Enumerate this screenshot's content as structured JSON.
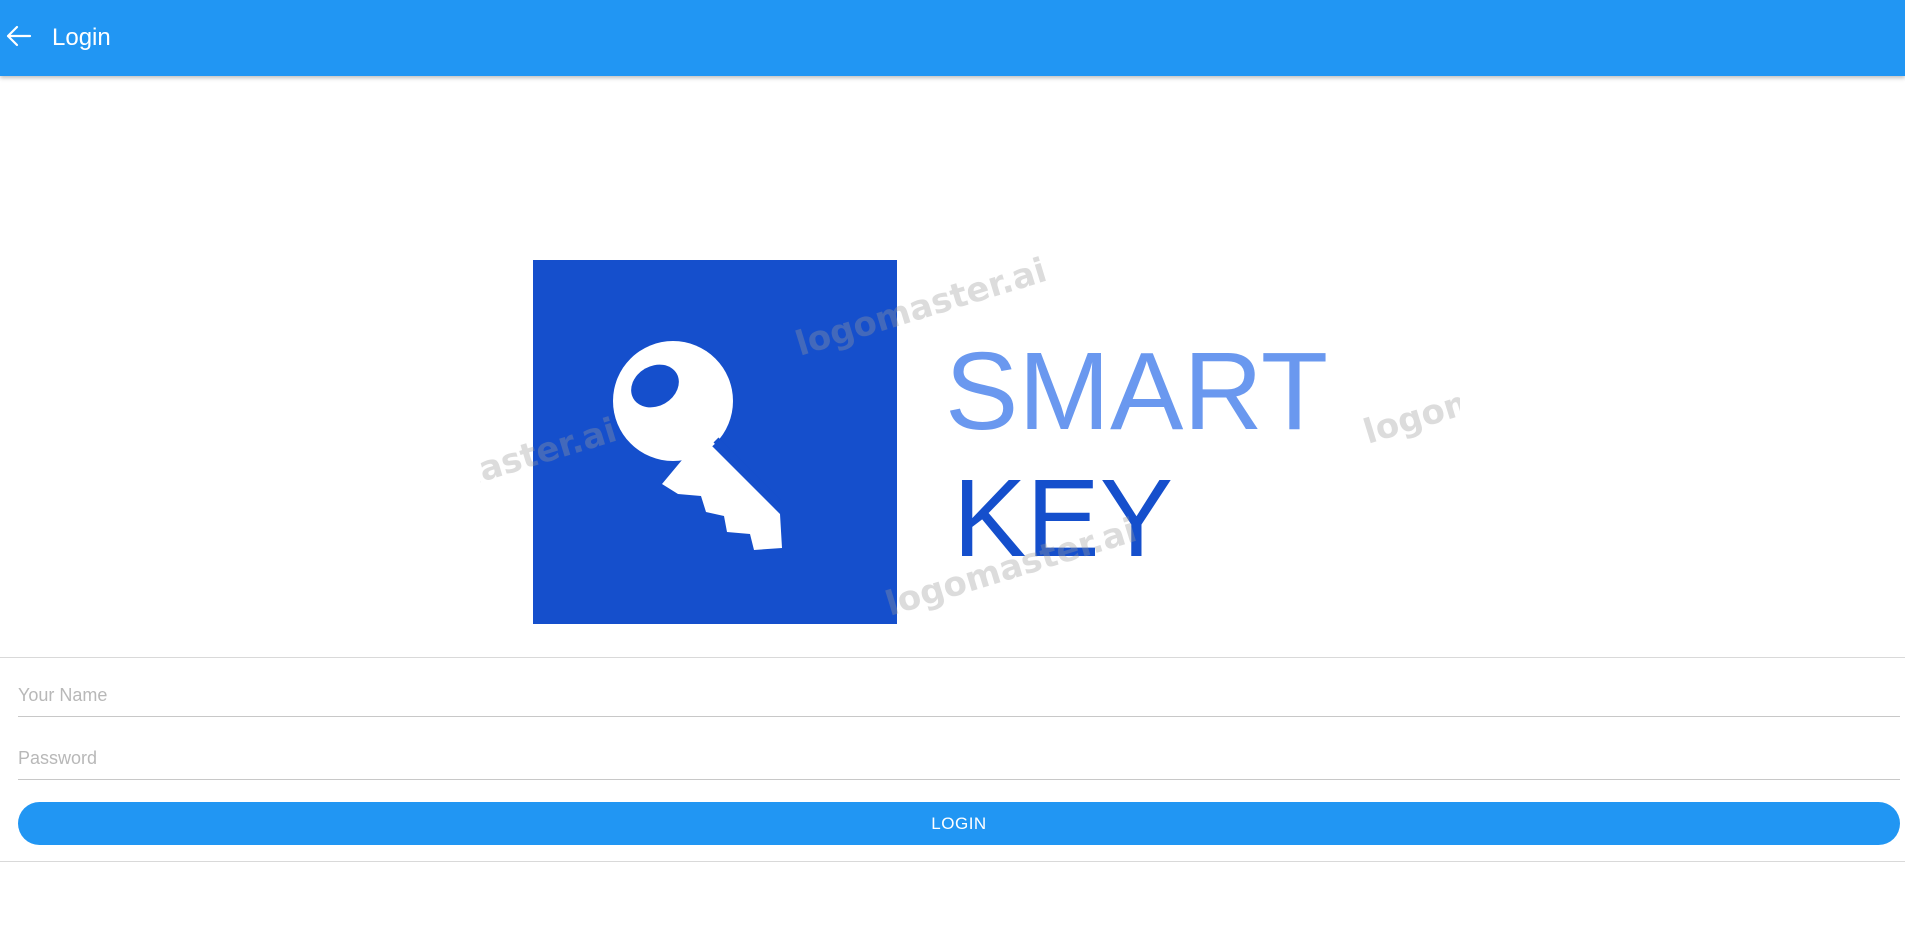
{
  "appbar": {
    "title": "Login",
    "back_icon": "arrow-left-icon",
    "background_color": "#2196f3"
  },
  "logo": {
    "line1": "SMART",
    "line2": "KEY",
    "watermark_text": "logomaster.ai",
    "square_color": "#154fcc",
    "line1_color": "#6a98ef",
    "line2_color": "#154fcc",
    "icon": "key-icon"
  },
  "form": {
    "name_placeholder": "Your Name",
    "name_value": "",
    "password_placeholder": "Password",
    "password_value": "",
    "login_label": "LOGIN",
    "button_color": "#2196f3"
  }
}
